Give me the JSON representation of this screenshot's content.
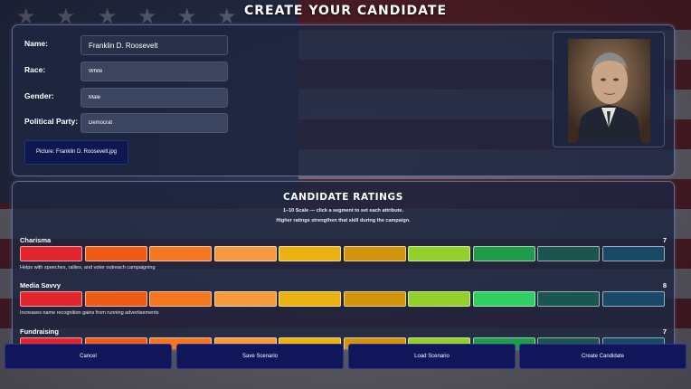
{
  "page": {
    "title": "CREATE YOUR CANDIDATE"
  },
  "form": {
    "name_label": "Name:",
    "name_value": "Franklin D. Roosevelt",
    "race_label": "Race:",
    "race_value": "White",
    "gender_label": "Gender:",
    "gender_value": "Male",
    "party_label": "Political Party:",
    "party_value": "Democrat",
    "picture_button": "Picture: Franklin D. Roosevelt.jpg"
  },
  "ratings": {
    "title": "CANDIDATE RATINGS",
    "subtitle_1": "1–10 Scale — click a segment to set each attribute.",
    "subtitle_2": "Higher ratings strengthen that skill during the campaign.",
    "segment_colors": [
      "#e3262d",
      "#ef5a14",
      "#f47720",
      "#f59a3e",
      "#eab20f",
      "#d1940c",
      "#93d12a",
      "#2fcf62",
      "#1f6f6a",
      "#1f5f86"
    ],
    "segment_dim_colors": [
      "#a8222a",
      "#b84a19",
      "#bb5b1c",
      "#b97332",
      "#b38a0f",
      "#9f720c",
      "#6e9c22",
      "#1f9b4a",
      "#1a5550",
      "#184a68"
    ],
    "attributes": [
      {
        "name": "Charisma",
        "value": "7",
        "level": 7,
        "description": "Helps with speeches, rallies, and voter outreach campaigning"
      },
      {
        "name": "Media Savvy",
        "value": "8",
        "level": 8,
        "description": "Increases name recognition gains from running advertisements"
      },
      {
        "name": "Fundraising",
        "value": "7",
        "level": 7,
        "description": ""
      }
    ]
  },
  "buttons": {
    "cancel": "Cancel",
    "save": "Save Scenario",
    "load": "Load Scenario",
    "create": "Create Candidate"
  },
  "colors": {
    "panel": "#1e2640",
    "button": "#11165a",
    "accent": "#0f1750"
  }
}
